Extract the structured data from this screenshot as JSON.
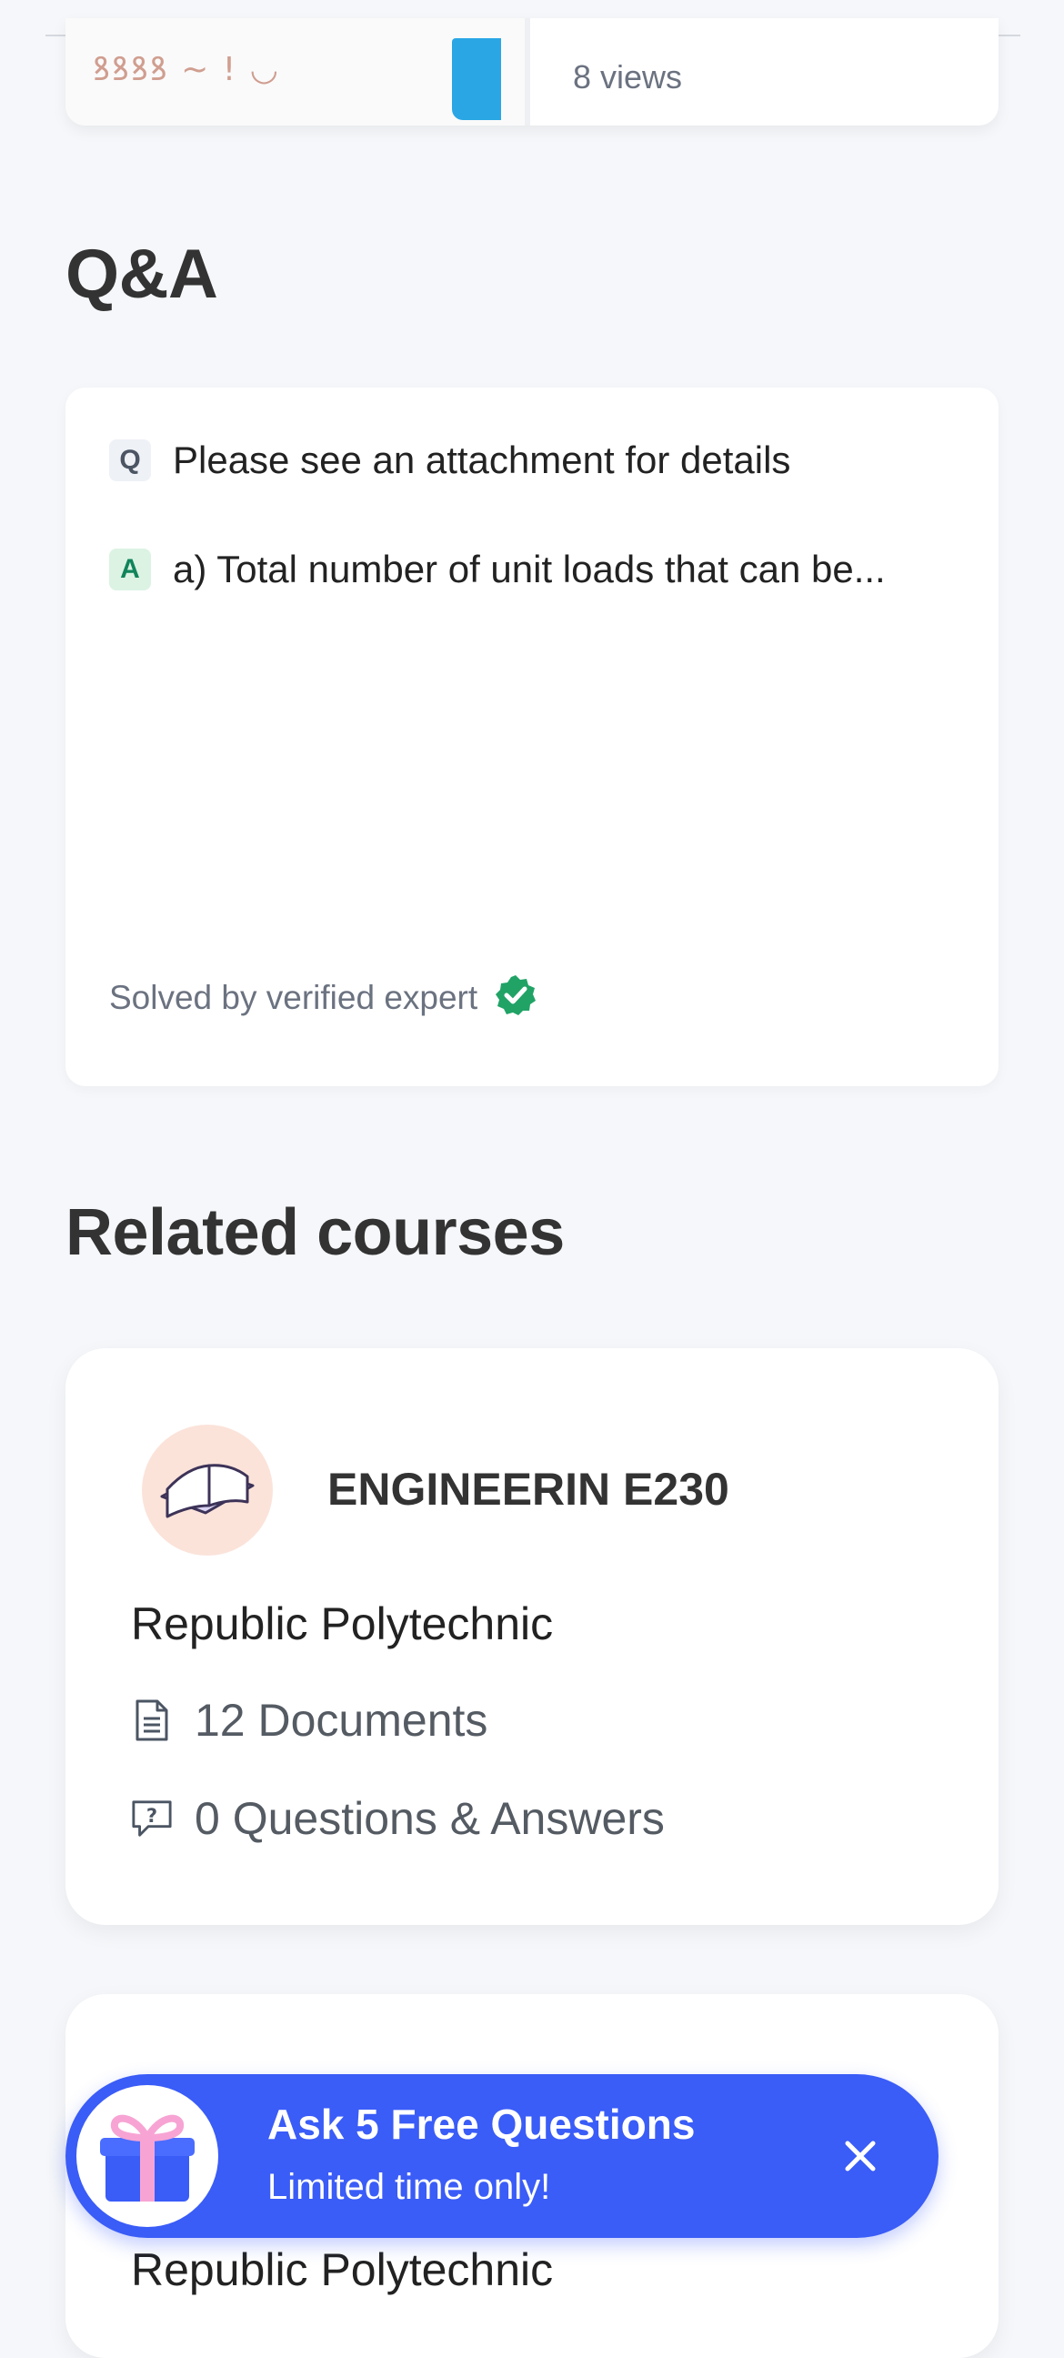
{
  "previous_item": {
    "views": "8 views"
  },
  "qa": {
    "title": "Q&A",
    "question_badge": "Q",
    "question": "Please see an attachment for details",
    "answer_badge": "A",
    "answer": "a) Total number of unit loads that can be...",
    "solved_label": "Solved by verified expert"
  },
  "related": {
    "title": "Related courses",
    "courses": [
      {
        "code": "ENGINEERIN E230",
        "school": "Republic Polytechnic",
        "documents": "12 Documents",
        "qa_count": "0 Questions & Answers"
      },
      {
        "school": "Republic Polytechnic"
      }
    ]
  },
  "promo": {
    "title": "Ask 5 Free Questions",
    "subtitle": "Limited time only!"
  },
  "colors": {
    "background": "#f5f7fa",
    "promo_blue": "#3a5cf7",
    "verified_green": "#21a366",
    "course_icon_bg": "#fbe3da"
  },
  "icons": [
    "book-icon",
    "document-icon",
    "question-bubble-icon",
    "verified-check-icon",
    "gift-icon",
    "close-icon"
  ]
}
